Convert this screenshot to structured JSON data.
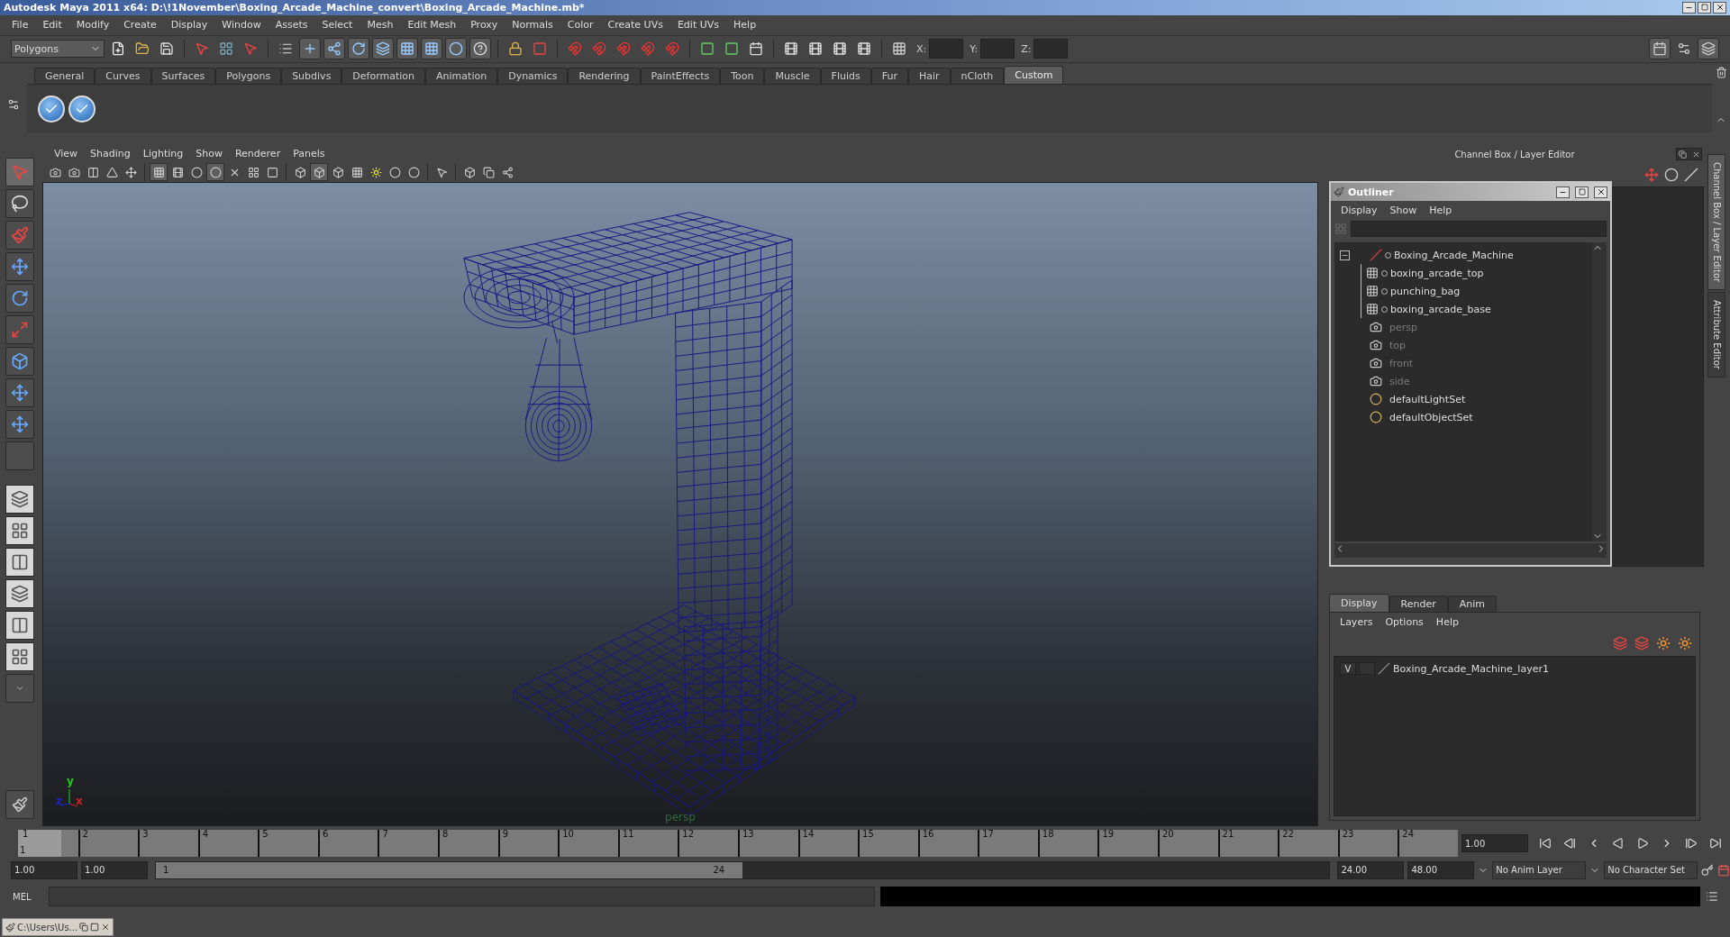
{
  "window": {
    "title": "Autodesk Maya 2011 x64: D:\\!1November\\Boxing_Arcade_Machine_convert\\Boxing_Arcade_Machine.mb*"
  },
  "menu_bar": [
    "File",
    "Edit",
    "Modify",
    "Create",
    "Display",
    "Window",
    "Assets",
    "Select",
    "Mesh",
    "Edit Mesh",
    "Proxy",
    "Normals",
    "Color",
    "Create UVs",
    "Edit UVs",
    "Help"
  ],
  "toolbar": {
    "mode": "Polygons",
    "coord_labels": [
      "X:",
      "Y:",
      "Z:"
    ]
  },
  "shelf": {
    "tabs": [
      {
        "label": "General",
        "selected": false
      },
      {
        "label": "Curves",
        "selected": false
      },
      {
        "label": "Surfaces",
        "selected": false
      },
      {
        "label": "Polygons",
        "selected": false
      },
      {
        "label": "Subdivs",
        "selected": false
      },
      {
        "label": "Deformation",
        "selected": false
      },
      {
        "label": "Animation",
        "selected": false
      },
      {
        "label": "Dynamics",
        "selected": false
      },
      {
        "label": "Rendering",
        "selected": false
      },
      {
        "label": "PaintEffects",
        "selected": false
      },
      {
        "label": "Toon",
        "selected": false
      },
      {
        "label": "Muscle",
        "selected": false
      },
      {
        "label": "Fluids",
        "selected": false
      },
      {
        "label": "Fur",
        "selected": false
      },
      {
        "label": "Hair",
        "selected": false
      },
      {
        "label": "nCloth",
        "selected": false
      },
      {
        "label": "Custom",
        "selected": true
      }
    ]
  },
  "viewport": {
    "menu": [
      "View",
      "Shading",
      "Lighting",
      "Show",
      "Renderer",
      "Panels"
    ],
    "camera": "persp",
    "axis_labels": [
      "y",
      "z",
      "x"
    ]
  },
  "channel_box": {
    "title": "Channel Box / Layer Editor",
    "side_tabs": [
      {
        "label": "Channel Box / Layer Editor",
        "selected": true
      },
      {
        "label": "Attribute Editor",
        "selected": false
      }
    ]
  },
  "outliner": {
    "title": "Outliner",
    "menu": [
      "Display",
      "Show",
      "Help"
    ],
    "items": [
      {
        "label": "Boxing_Arcade_Machine",
        "kind": "group",
        "dimmed": false,
        "expanded": true,
        "children": [
          {
            "label": "boxing_arcade_top",
            "kind": "mesh",
            "dimmed": false
          },
          {
            "label": "punching_bag",
            "kind": "mesh",
            "dimmed": false
          },
          {
            "label": "boxing_arcade_base",
            "kind": "mesh",
            "dimmed": false
          }
        ]
      },
      {
        "label": "persp",
        "kind": "camera",
        "dimmed": true
      },
      {
        "label": "top",
        "kind": "camera",
        "dimmed": true
      },
      {
        "label": "front",
        "kind": "camera",
        "dimmed": true
      },
      {
        "label": "side",
        "kind": "camera",
        "dimmed": true
      },
      {
        "label": "defaultLightSet",
        "kind": "set",
        "dimmed": false
      },
      {
        "label": "defaultObjectSet",
        "kind": "set",
        "dimmed": false
      }
    ]
  },
  "layer_editor": {
    "tabs": [
      {
        "label": "Display",
        "selected": true
      },
      {
        "label": "Render",
        "selected": false
      },
      {
        "label": "Anim",
        "selected": false
      }
    ],
    "menu": [
      "Layers",
      "Options",
      "Help"
    ],
    "layers": [
      {
        "name": "Boxing_Arcade_Machine_layer1",
        "visibility": "V"
      }
    ]
  },
  "time_slider": {
    "ticks": [
      {
        "label": "1",
        "selected": true
      },
      {
        "label": "2",
        "selected": false
      },
      {
        "label": "3",
        "selected": false
      },
      {
        "label": "4",
        "selected": false
      },
      {
        "label": "5",
        "selected": false
      },
      {
        "label": "6",
        "selected": false
      },
      {
        "label": "7",
        "selected": false
      },
      {
        "label": "8",
        "selected": false
      },
      {
        "label": "9",
        "selected": false
      },
      {
        "label": "10",
        "selected": false
      },
      {
        "label": "11",
        "selected": false
      },
      {
        "label": "12",
        "selected": false
      },
      {
        "label": "13",
        "selected": false
      },
      {
        "label": "14",
        "selected": false
      },
      {
        "label": "15",
        "selected": false
      },
      {
        "label": "16",
        "selected": false
      },
      {
        "label": "17",
        "selected": false
      },
      {
        "label": "18",
        "selected": false
      },
      {
        "label": "19",
        "selected": false
      },
      {
        "label": "20",
        "selected": false
      },
      {
        "label": "21",
        "selected": false
      },
      {
        "label": "22",
        "selected": false
      },
      {
        "label": "23",
        "selected": false
      },
      {
        "label": "24",
        "selected": false
      }
    ],
    "current_frame": "1",
    "current_time": "1.00"
  },
  "range_slider": {
    "start": "1.00",
    "playback_start": "1.00",
    "range_start": "1",
    "range_end": "24",
    "level": 0.5,
    "playback_end": "24.00",
    "end": "48.00",
    "anim_layer": "No Anim Layer",
    "character_set": "No Character Set"
  },
  "command_line": {
    "label": "MEL"
  },
  "taskbar": {
    "label": "C:\\Users\\Us..."
  }
}
